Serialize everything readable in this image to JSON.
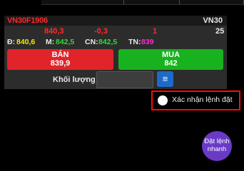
{
  "header": {
    "symbol": "VN30F1906",
    "index_name": "VN30"
  },
  "quote": {
    "price": "840,3",
    "change": "-0,3",
    "volume": "1",
    "count": "25"
  },
  "levels": {
    "d_label": "Đ:",
    "d_value": "840,6",
    "m_label": "M:",
    "m_value": "842,5",
    "cn_label": "CN:",
    "cn_value": "842,5",
    "tn_label": "TN:",
    "tn_value": "839"
  },
  "sell": {
    "label": "BÁN",
    "price": "839,9"
  },
  "buy": {
    "label": "MUA",
    "price": "842"
  },
  "quantity": {
    "label": "Khối lượng",
    "value": "",
    "menu_icon": "menu-icon"
  },
  "confirm": {
    "label": "Xác nhận lệnh đặt",
    "checked": false
  },
  "fab": {
    "line1": "Đặt lệnh",
    "line2": "nhanh"
  },
  "colors": {
    "sell": "#e1242a",
    "buy": "#18b21f",
    "accent": "#1d6ac9",
    "fab": "#6a3ac7",
    "highlight": "#ff0a0a",
    "down": "#ff2a2a",
    "yellow": "#f2e600",
    "green": "#2fdc2f",
    "magenta": "#ff2bd3"
  }
}
